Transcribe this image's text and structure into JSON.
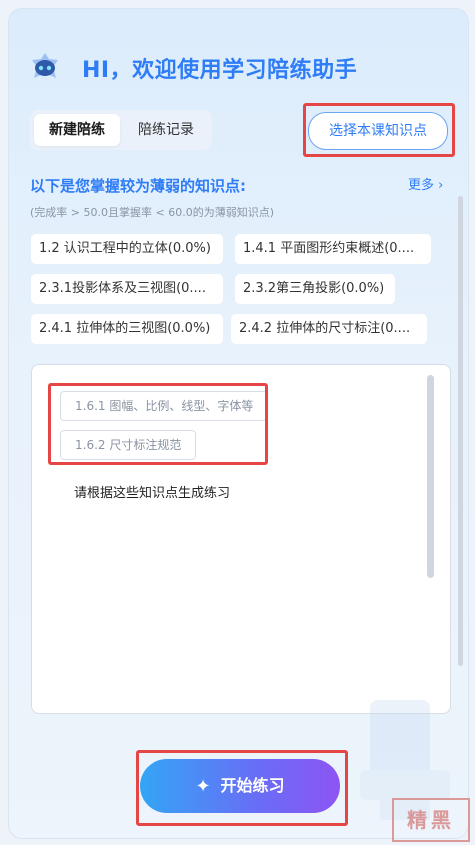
{
  "greeting": "HI，欢迎使用学习陪练助手",
  "tabs": [
    "新建陪练",
    "陪练记录"
  ],
  "select_button_label": "选择本课知识点",
  "weak_section": {
    "title": "以下是您掌握较为薄弱的知识点:",
    "more_label": "更多",
    "subtitle": "(完成率 > 50.0且掌握率 < 60.0的为薄弱知识点)",
    "points": [
      "1.2 认识工程中的立体(0.0%)",
      "1.4.1 平面图形约束概述(0....",
      "2.3.1投影体系及三视图(0....",
      "2.3.2第三角投影(0.0%)",
      "2.4.1 拉伸体的三视图(0.0%)",
      "2.4.2 拉伸体的尺寸标注(0...."
    ]
  },
  "input": {
    "selected_tags": [
      "1.6.1 图幅、比例、线型、字体等",
      "1.6.2 尺寸标注规范"
    ],
    "prompt_text": "请根据这些知识点生成练习"
  },
  "start_button_label": "开始练习",
  "watermark_text": "精黑",
  "colors": {
    "accent": "#2f7df6",
    "highlight_box": "#e64545",
    "button_gradient_start": "#33a6f5",
    "button_gradient_end": "#8d55f3"
  }
}
